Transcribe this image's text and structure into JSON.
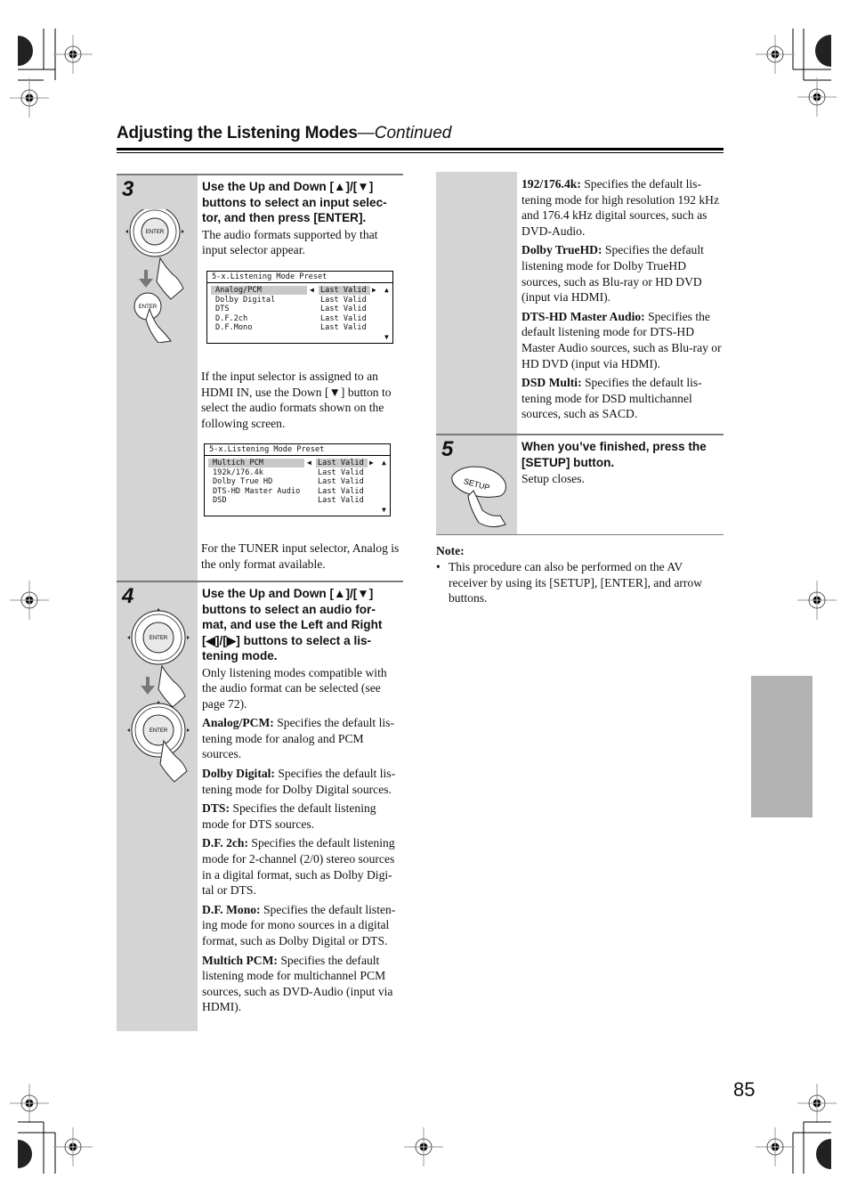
{
  "header": {
    "title": "Adjusting the Listening Modes",
    "continued": "—Continued"
  },
  "steps": {
    "step3": {
      "number": "3",
      "heading": "Use the Up and Down [▲]/[▼] buttons to select an input selec-tor, and then press [ENTER].",
      "heading_lines": [
        "Use the Up and Down [▲]/[▼]",
        "buttons to select an input selec-",
        "tor, and then press [ENTER]."
      ],
      "text1": "The audio formats supported by that input selector appear.",
      "text2": "If the input selector is assigned to an HDMI IN, use the Down [▼] button to select the audio formats shown on the following screen.",
      "text3": "For the TUNER input selector, Analog is the only format available.",
      "icons": [
        "remote-enter-dial",
        "press-enter-hand"
      ],
      "osd1": {
        "title": "5-x.Listening Mode Preset",
        "rows": [
          {
            "label": "Analog/PCM",
            "value": "Last Valid",
            "selected": true
          },
          {
            "label": "Dolby Digital",
            "value": "Last Valid",
            "selected": false
          },
          {
            "label": "DTS",
            "value": "Last Valid",
            "selected": false
          },
          {
            "label": "D.F.2ch",
            "value": "Last Valid",
            "selected": false
          },
          {
            "label": "D.F.Mono",
            "value": "Last Valid",
            "selected": false
          }
        ],
        "left_arrow": "◀",
        "right_arrow": "▶",
        "up_arrow": "▲",
        "down_arrow": "▼"
      },
      "osd2": {
        "title": "5-x.Listening Mode Preset",
        "rows": [
          {
            "label": "Multich PCM",
            "value": "Last Valid",
            "selected": true
          },
          {
            "label": "192k/176.4k",
            "value": "Last Valid",
            "selected": false
          },
          {
            "label": "Dolby True HD",
            "value": "Last Valid",
            "selected": false
          },
          {
            "label": "DTS-HD Master Audio",
            "value": "Last Valid",
            "selected": false
          },
          {
            "label": "DSD",
            "value": "Last Valid",
            "selected": false
          }
        ],
        "left_arrow": "◀",
        "right_arrow": "▶",
        "up_arrow": "▲",
        "down_arrow": "▼"
      }
    },
    "step4": {
      "number": "4",
      "heading_lines": [
        "Use the Up and Down [▲]/[▼]",
        "buttons to select an audio for-",
        "mat, and use the Left and Right",
        "[◀]/[▶] buttons to select a lis-",
        "tening mode."
      ],
      "intro": "Only listening modes compatible with the audio format can be selected (see page 72).",
      "definitions": [
        {
          "term": "Analog/PCM:",
          "desc": " Specifies the default lis-tening mode for analog and PCM sources."
        },
        {
          "term": "Dolby Digital:",
          "desc": " Specifies the default lis-tening mode for Dolby Digital sources."
        },
        {
          "term": "DTS:",
          "desc": " Specifies the default listening mode for DTS sources."
        },
        {
          "term": "D.F. 2ch:",
          "desc": " Specifies the default listening mode for 2-channel (2/0) stereo sources in a digital format, such as Dolby Digi-tal or DTS."
        },
        {
          "term": "D.F. Mono:",
          "desc": " Specifies the default listen-ing mode for mono sources in a digital format, such as Dolby Digital or DTS."
        },
        {
          "term": "Multich PCM:",
          "desc": " Specifies the default listening mode for multichannel PCM sources, such as DVD-Audio (input via HDMI)."
        }
      ]
    },
    "step4_cont": {
      "definitions": [
        {
          "term": "192/176.4k:",
          "desc": " Specifies the default lis-tening mode for high resolution 192 kHz and 176.4 kHz digital sources, such as DVD-Audio."
        },
        {
          "term": "Dolby TrueHD:",
          "desc": " Specifies the default listening mode for Dolby TrueHD sources, such as Blu-ray or HD DVD (input via HDMI)."
        },
        {
          "term": "DTS-HD Master Audio:",
          "desc": " Specifies the default listening mode for DTS-HD Master Audio sources, such as Blu-ray or HD DVD (input via HDMI)."
        },
        {
          "term": "DSD Multi:",
          "desc": " Specifies the default lis-tening mode for DSD multichannel sources, such as SACD."
        }
      ]
    },
    "step5": {
      "number": "5",
      "heading_lines": [
        "When you’ve finished, press the",
        "[SETUP] button."
      ],
      "text": "Setup closes.",
      "button_label": "SETUP"
    }
  },
  "note": {
    "label": "Note:",
    "bullet": "•",
    "text": "This procedure can also be performed on the AV receiver by using its [SETUP], [ENTER], and arrow buttons."
  },
  "dial_label": "ENTER",
  "page_number": "85"
}
